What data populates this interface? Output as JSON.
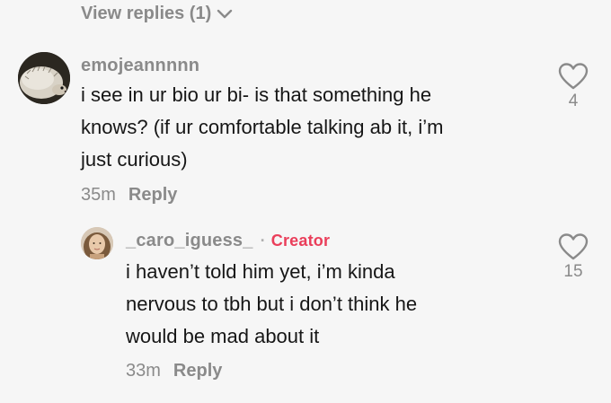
{
  "view_replies": {
    "label": "View replies (1)"
  },
  "comment": {
    "username": "emojeannnnn",
    "text": "i see in ur bio ur bi- is that something he\nknows? (if ur comfortable talking ab it, i’m\njust curious)",
    "time": "35m",
    "reply_label": "Reply",
    "likes": "4"
  },
  "reply": {
    "username": "_caro_iguess_",
    "separator": "·",
    "badge": "Creator",
    "text": "i haven’t told him yet, i’m kinda\nnervous to tbh but i don’t think he\nwould be mad about it",
    "time": "33m",
    "reply_label": "Reply",
    "likes": "15"
  },
  "colors": {
    "background": "#f6f6f6",
    "muted_text": "#8a8a8a",
    "body_text": "#161616",
    "creator_badge": "#ea3e5a"
  },
  "icons": {
    "expand": "chevron-down-icon",
    "like": "heart-outline-icon"
  }
}
